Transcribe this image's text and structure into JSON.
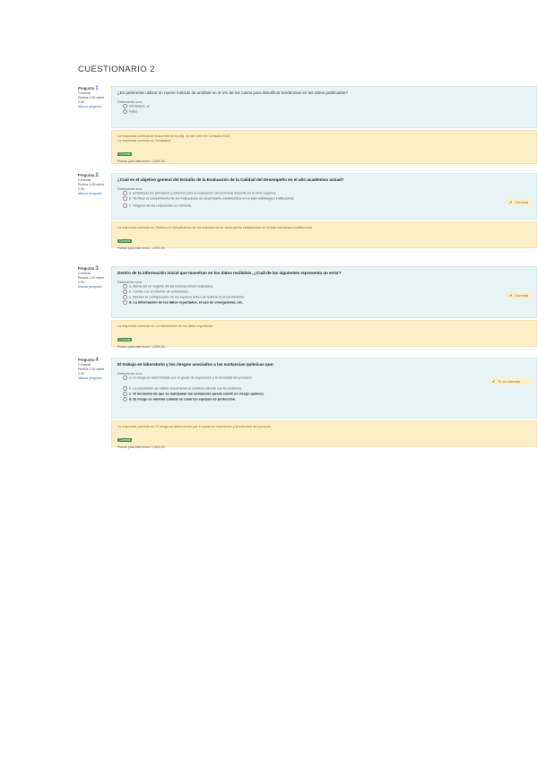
{
  "page": {
    "title": "CUESTIONARIO 2"
  },
  "questions": [
    {
      "info": {
        "label": "Pregunta",
        "num": "1",
        "state": "Correcta",
        "score": "Puntúa 1,00 sobre 1,00",
        "flag": "Marcar pregunta"
      },
      "text": "¿Es pertinente utilizar un nuevo método de análisis en el 1% de los casos para identificar tendencias en los datos publicados?",
      "prompt": "Seleccione una:",
      "options": [
        {
          "label": "Verdadero",
          "mark": "✔"
        },
        {
          "label": "Falso",
          "mark": ""
        }
      ],
      "tag": "",
      "feedback": {
        "text": "La respuesta correcta se encuentra en la pág. 34 del Libro de Consulta 2023",
        "sub": "La respuesta correcta es 'Verdadero'",
        "badge": "Correcta",
        "note": "Puntos para este envío: 1,00/1,00."
      }
    },
    {
      "info": {
        "label": "Pregunta",
        "num": "2",
        "state": "Correcta",
        "score": "Puntúa 1,00 sobre 1,00",
        "flag": "Marcar pregunta"
      },
      "text": "¿Cuál es el objetivo general del Estudio de la Evaluación de la Calidad del Desempeño en el año académico actual?",
      "prompt": "Seleccione una:",
      "options": [
        {
          "label": "a. Establecer los principios y criterios para la evaluación del personal docente en el nivel superior.",
          "mark": ""
        },
        {
          "label": "b. Verificar el cumplimiento de los indicadores de desempeño establecidos en el plan estratégico institucional.",
          "mark": ""
        },
        {
          "label": "c. Ninguna de las respuestas es correcta.",
          "mark": ""
        }
      ],
      "tag": "Correcta",
      "feedback": {
        "text": "La respuesta correcta es: Verificar el cumplimiento de los indicadores de desempeño establecidos en el plan estratégico institucional.",
        "sub": "",
        "badge": "Correcta",
        "note": "Puntos para este envío: 1,00/1,00."
      }
    },
    {
      "info": {
        "label": "Pregunta",
        "num": "3",
        "state": "Correcta",
        "score": "Puntúa 1,00 sobre 1,00",
        "flag": "Marcar pregunta"
      },
      "text": "Dentro de la información inicial que muestran en los datos recibidos, ¿Cuál de las siguientes representa un error?",
      "prompt": "Seleccione una:",
      "options": [
        {
          "label": "a. Mantener un registro de las transacciones realizadas.",
          "mark": ""
        },
        {
          "label": "b. Contar con el informe de actividades.",
          "mark": ""
        },
        {
          "label": "c. Revisar la configuración de los equipos antes de realizar el procedimiento.",
          "mark": ""
        },
        {
          "label": "d. La información de los datos reportados, el uso de emergencias, etc.",
          "mark": ""
        }
      ],
      "tag": "Correcta",
      "feedback": {
        "text": "La respuesta correcta es: La información de los datos reportados.",
        "sub": "",
        "badge": "Correcta",
        "note": "Puntos para este envío: 1,00/1,00."
      }
    },
    {
      "info": {
        "label": "Pregunta",
        "num": "4",
        "state": "Correcta",
        "score": "Puntúa 1,00 sobre 1,00",
        "flag": "Marcar pregunta"
      },
      "text": "El trabajo en laboratorio y los riesgos asociados a las sustancias químicas que:",
      "prompt": "Seleccione una:",
      "options": [
        {
          "label": "a. El riesgo es determinado por el grado de exposición y la toxicidad del producto.",
          "mark": ""
        },
        {
          "label": "b. La exposición se refiere únicamente al contacto directo con la sustancia.",
          "mark": ""
        },
        {
          "label": "c. Al momento de que se manipulan las sustancias puede existir un riesgo químico.",
          "mark": ""
        },
        {
          "label": "d. El riesgo es mínimo cuando se usan los equipos de protección.",
          "mark": ""
        }
      ],
      "tag": "Sí, es correcta.",
      "feedback": {
        "text": "La respuesta correcta es: El riesgo es determinado por el grado de exposición y la toxicidad del producto.",
        "sub": "",
        "badge": "Correcta",
        "note": "Puntos para este envío: 1,00/1,00."
      }
    }
  ]
}
